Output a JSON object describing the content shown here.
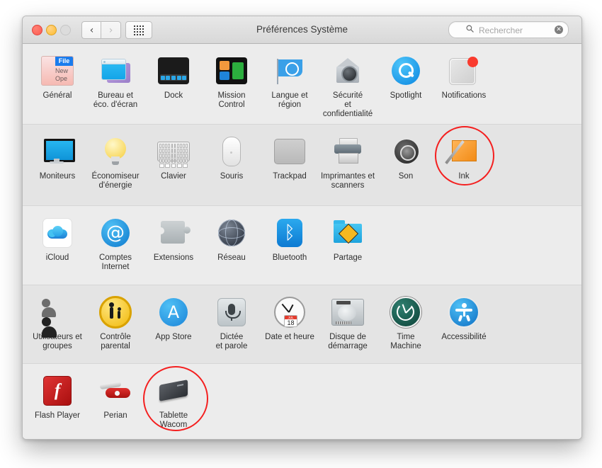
{
  "window": {
    "title": "Préférences Système",
    "traffic_lights": [
      "close",
      "minimize",
      "zoom"
    ],
    "nav": {
      "back": "‹",
      "forward": "›"
    },
    "show_all_button": "show-all-grid"
  },
  "search": {
    "placeholder": "Rechercher",
    "value": "",
    "clear_glyph": "✕"
  },
  "rows": [
    {
      "shade": "plain",
      "items": [
        {
          "name": "general",
          "label": "Général",
          "icon": "general-icon",
          "menu": {
            "file": "File",
            "new": "New",
            "open": "Ope"
          }
        },
        {
          "name": "desktop",
          "label": "Bureau et\néco. d'écran",
          "icon": "desktop-screensaver-icon"
        },
        {
          "name": "dock",
          "label": "Dock",
          "icon": "dock-icon"
        },
        {
          "name": "mission-control",
          "label": "Mission\nControl",
          "icon": "mission-control-icon"
        },
        {
          "name": "language",
          "label": "Langue et\nrégion",
          "icon": "language-region-flag-icon"
        },
        {
          "name": "security",
          "label": "Sécurité\net confidentialité",
          "icon": "security-privacy-icon"
        },
        {
          "name": "spotlight",
          "label": "Spotlight",
          "icon": "spotlight-icon"
        },
        {
          "name": "notifications",
          "label": "Notifications",
          "icon": "notifications-icon"
        }
      ]
    },
    {
      "shade": "alt",
      "items": [
        {
          "name": "displays",
          "label": "Moniteurs",
          "icon": "monitor-icon"
        },
        {
          "name": "energy",
          "label": "Économiseur\nd'énergie",
          "icon": "lightbulb-icon"
        },
        {
          "name": "keyboard",
          "label": "Clavier",
          "icon": "keyboard-icon"
        },
        {
          "name": "mouse",
          "label": "Souris",
          "icon": "mouse-icon"
        },
        {
          "name": "trackpad",
          "label": "Trackpad",
          "icon": "trackpad-icon"
        },
        {
          "name": "printers",
          "label": "Imprimantes et\nscanners",
          "icon": "printer-icon"
        },
        {
          "name": "sound",
          "label": "Son",
          "icon": "speaker-icon"
        },
        {
          "name": "ink",
          "label": "Ink",
          "icon": "ink-pen-icon",
          "highlighted": true
        }
      ]
    },
    {
      "shade": "plain",
      "items": [
        {
          "name": "icloud",
          "label": "iCloud",
          "icon": "icloud-icon"
        },
        {
          "name": "internet-accounts",
          "label": "Comptes\nInternet",
          "icon": "at-sign-icon"
        },
        {
          "name": "extensions",
          "label": "Extensions",
          "icon": "puzzle-piece-icon"
        },
        {
          "name": "network",
          "label": "Réseau",
          "icon": "globe-icon"
        },
        {
          "name": "bluetooth",
          "label": "Bluetooth",
          "icon": "bluetooth-icon"
        },
        {
          "name": "sharing",
          "label": "Partage",
          "icon": "sharing-folder-icon"
        }
      ]
    },
    {
      "shade": "alt",
      "items": [
        {
          "name": "users-groups",
          "label": "Utilisateurs et\ngroupes",
          "icon": "users-icon"
        },
        {
          "name": "parental",
          "label": "Contrôle\nparental",
          "icon": "parental-controls-icon"
        },
        {
          "name": "app-store",
          "label": "App Store",
          "icon": "app-store-icon"
        },
        {
          "name": "dictation",
          "label": "Dictée\net parole",
          "icon": "microphone-icon"
        },
        {
          "name": "date-time",
          "label": "Date et heure",
          "icon": "clock-icon",
          "calendar": {
            "month": "JUL",
            "day": "18"
          }
        },
        {
          "name": "startup-disk",
          "label": "Disque de\ndémarrage",
          "icon": "hard-disk-icon"
        },
        {
          "name": "time-machine",
          "label": "Time\nMachine",
          "icon": "time-machine-icon"
        },
        {
          "name": "accessibility",
          "label": "Accessibilité",
          "icon": "accessibility-icon"
        }
      ]
    },
    {
      "shade": "plain",
      "items": [
        {
          "name": "flash-player",
          "label": "Flash Player",
          "icon": "flash-player-icon",
          "glyph": "f"
        },
        {
          "name": "perian",
          "label": "Perian",
          "icon": "perian-knife-icon"
        },
        {
          "name": "wacom-tablet",
          "label": "Tablette Wacom",
          "icon": "wacom-tablet-icon",
          "highlighted": true
        }
      ]
    }
  ],
  "colors": {
    "annotation_red": "#f41f1f",
    "window_bg": "#ececec",
    "row_alt_bg": "#e4e4e4",
    "titlebar_top": "#e8e8e8",
    "accent_blue": "#1f7fd4"
  }
}
